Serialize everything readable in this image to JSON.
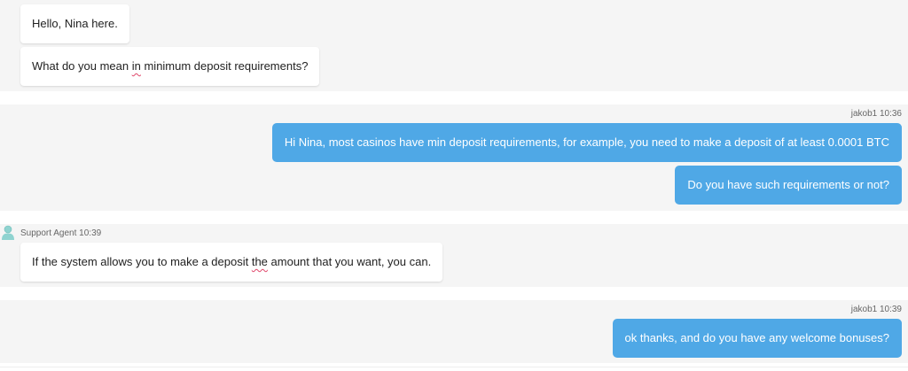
{
  "messages": [
    {
      "text": "Hello, Nina here."
    },
    {
      "before": "What do you mean ",
      "flagged": "in",
      "after": " minimum deposit requirements?"
    },
    {
      "meta": "jakob1 10:36",
      "text": "Hi Nina, most casinos have min deposit requirements, for example, you need to make a deposit of at least 0.0001 BTC"
    },
    {
      "text": "Do you have such requirements or not?"
    },
    {
      "meta": "Support Agent 10:39",
      "before": "If the system allows you to make a deposit ",
      "flagged": "the",
      "after": " amount that you want, you can."
    },
    {
      "meta": "jakob1 10:39",
      "text": "ok thanks, and do you have any welcome bonuses?"
    }
  ],
  "colors": {
    "outgoing_bubble": "#4fa8e6",
    "incoming_bubble": "#ffffff",
    "spellcheck_underline": "#e0476a",
    "background_band": "#f5f5f5"
  },
  "icons": {
    "agent_avatar": "user-avatar-icon"
  }
}
